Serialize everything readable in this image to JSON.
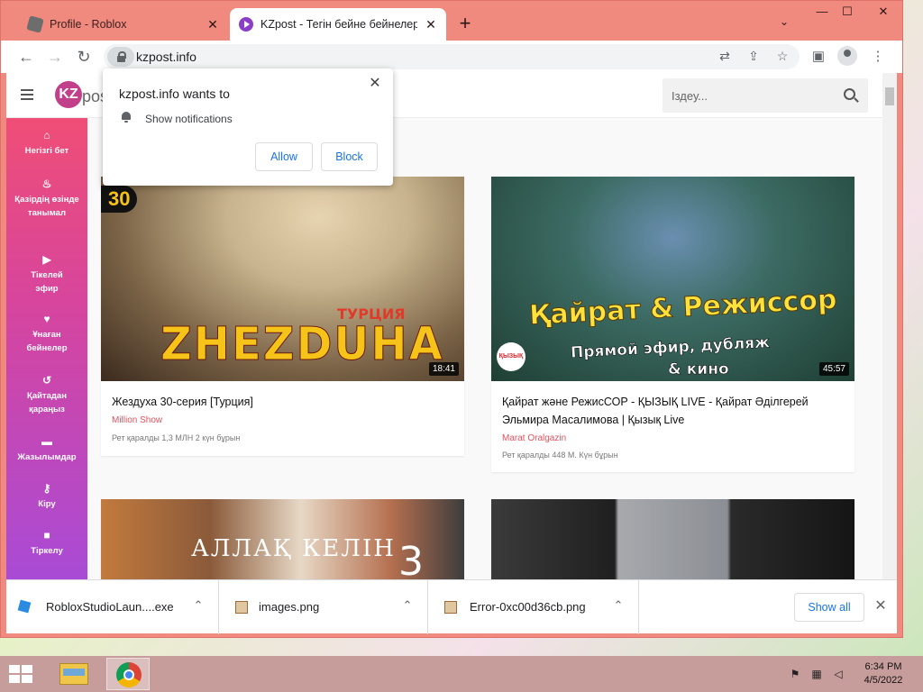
{
  "browser": {
    "tabs": [
      {
        "title": "Profile - Roblox",
        "active": false
      },
      {
        "title": "KZpost - Тегін бейне бейнелерді",
        "active": true
      }
    ],
    "new_tab": "+",
    "tab_search": "⌄",
    "window_controls": {
      "minimize": "—",
      "maximize": "☐",
      "close": "✕"
    },
    "url": "kzpost.info"
  },
  "site": {
    "logo": "KZ",
    "logo_text": "post",
    "search_placeholder": "Іздеу...",
    "sidebar": [
      {
        "icon": "home-icon",
        "glyph": "⌂",
        "label": "Негізгі бет"
      },
      {
        "icon": "fire-icon",
        "glyph": "🔥",
        "label": "Қазірдің өзінде танымал"
      },
      {
        "icon": "play-icon",
        "glyph": "▶",
        "label": "Тікелей эфир"
      },
      {
        "icon": "heart-icon",
        "glyph": "♥",
        "label": "Ұнаған бейнелер"
      },
      {
        "icon": "history-icon",
        "glyph": "↺",
        "label": "Қайтадан қараңыз"
      },
      {
        "icon": "folder-icon",
        "glyph": "▬",
        "label": "Жазылымдар"
      },
      {
        "icon": "key-icon",
        "glyph": "⚷",
        "label": "Кіру"
      },
      {
        "icon": "lock-icon",
        "glyph": "🔒",
        "label": "Тіркелу"
      }
    ],
    "videos": [
      {
        "title": "Жездуха 30-серия [Турция]",
        "channel": "Million Show",
        "meta": "Рет қаралды 1,3 МЛН   2 күн бұрын",
        "duration": "18:41",
        "thumb_text": "ZHEZDUHA",
        "thumb_badge": "30",
        "thumb_sub": "ТУРЦИЯ"
      },
      {
        "title": "Қайрат және РежисСОР - ҚЫЗЫҚ LIVE - Қайрат Әділгерей Эльмира Масалимова | Қызық Live",
        "channel": "Marat Oralgazin",
        "meta": "Рет қаралды 448 М.   Күн бұрын",
        "duration": "45:57",
        "thumb_line1": "Қайрат & Режиссор",
        "thumb_line2": "Прямой эфир, дубляж",
        "thumb_line3": "& кино",
        "thumb_logo": "ҚЫЗЫҚ LIVE"
      },
      {
        "thumb_text": "АЛЛАҚ КЕЛІН",
        "thumb_num": "3"
      },
      {}
    ]
  },
  "notification_popup": {
    "title": "kzpost.info wants to",
    "message": "Show notifications",
    "allow": "Allow",
    "block": "Block"
  },
  "downloads": {
    "items": [
      {
        "name": "RobloxStudioLaun....exe",
        "icon": "roblox-file-icon"
      },
      {
        "name": "images.png",
        "icon": "image-file-icon"
      },
      {
        "name": "Error-0xc00d36cb.png",
        "icon": "image-file-icon"
      }
    ],
    "show_all": "Show all"
  },
  "taskbar": {
    "time": "6:34 PM",
    "date": "4/5/2022"
  }
}
